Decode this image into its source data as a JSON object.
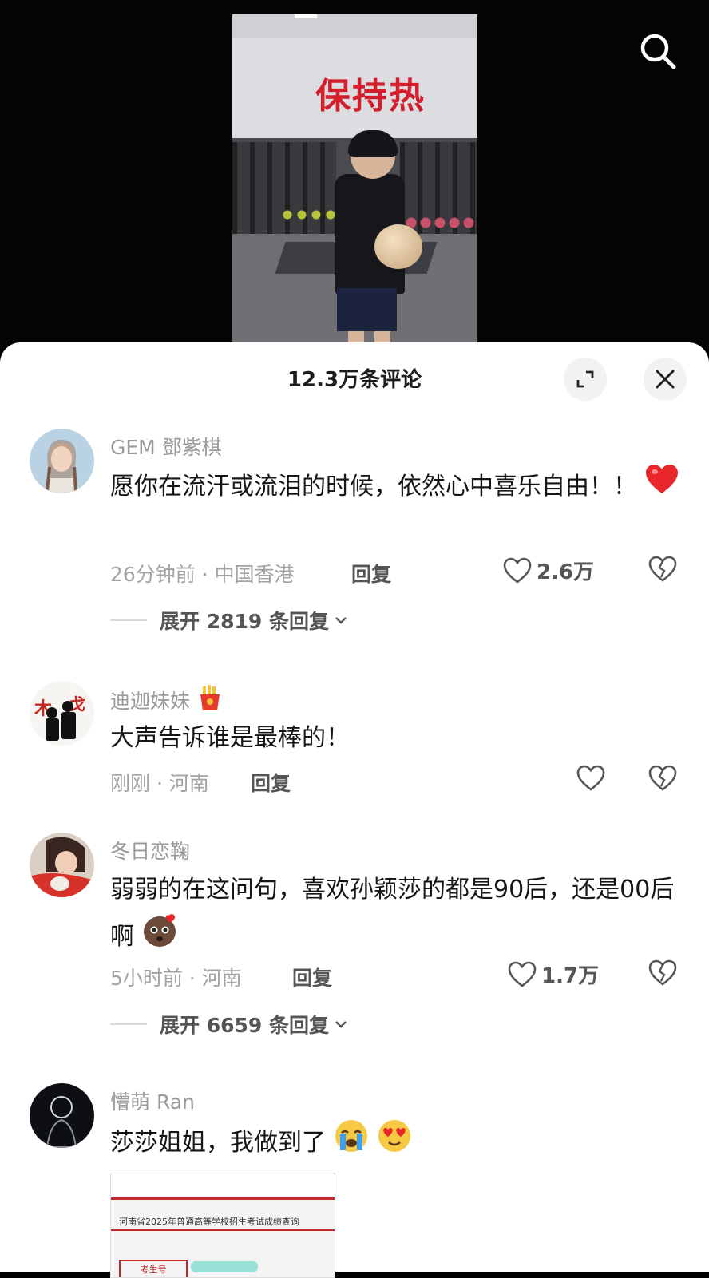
{
  "video": {
    "banner_text": "保持热"
  },
  "sheet": {
    "title": "12.3万条评论"
  },
  "comments": [
    {
      "username": "GEM 鄧紫棋",
      "text": "愿你在流汗或流泪的时候，依然心中喜乐自由！！",
      "text_emoji": "red-heart",
      "time_location": "26分钟前 · 中国香港",
      "reply_label": "回复",
      "like_count": "2.6万",
      "expand_label": "展开 2819 条回复"
    },
    {
      "username": "迪迦妹妹",
      "username_badge": "fries-emoji",
      "text": "大声告诉谁是最棒的！",
      "time_location": "刚刚 · 河南",
      "reply_label": "回复",
      "like_count": ""
    },
    {
      "username": "冬日恋鞠",
      "text": "弱弱的在这问句，喜欢孙颖莎的都是90后，还是00后啊",
      "text_emoji": "shy-face",
      "time_location": "5小时前 · 河南",
      "reply_label": "回复",
      "like_count": "1.7万",
      "expand_label": "展开 6659 条回复"
    },
    {
      "username": "懵萌 Ran",
      "text": "莎莎姐姐，我做到了",
      "text_emoji": [
        "crying-face",
        "heart-eyes-face"
      ],
      "attachment": {
        "caption": "河南省2025年普通高等学校招生考试成绩查询",
        "field_label": "考生号"
      }
    }
  ],
  "icons": {
    "search": "search-icon",
    "expand": "expand-icon",
    "close": "close-icon",
    "like": "heart-outline-icon",
    "dislike": "broken-heart-icon",
    "chevron": "chevron-down-icon"
  }
}
